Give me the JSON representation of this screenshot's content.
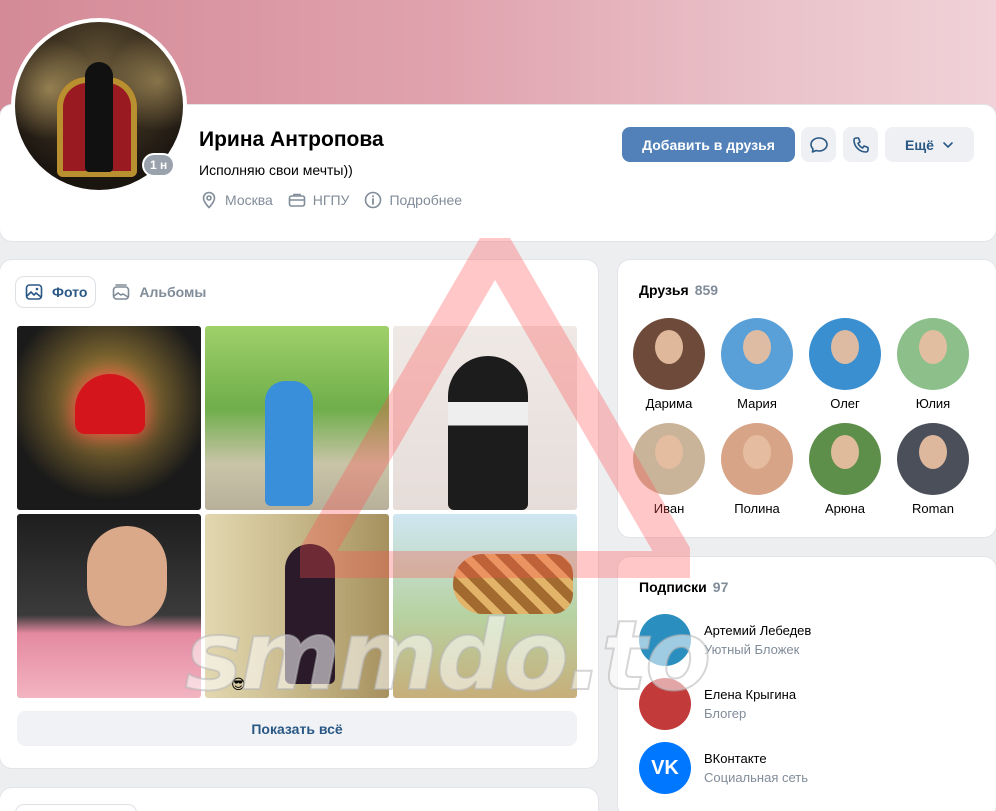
{
  "profile": {
    "name": "Ирина Антропова",
    "status": "Исполняю свои мечты))",
    "online": "1 н",
    "city": "Москва",
    "university": "НГПУ",
    "more_info": "Подробнее"
  },
  "actions": {
    "add_friend": "Добавить в друзья",
    "more": "Ещё",
    "message_icon": "message-icon",
    "call_icon": "phone-icon"
  },
  "photos": {
    "tabs": [
      {
        "label": "Фото",
        "active": true
      },
      {
        "label": "Альбомы",
        "active": false
      }
    ],
    "emoji": "😎",
    "show_all": "Показать всё"
  },
  "friends": {
    "title": "Друзья",
    "count": "859",
    "items": [
      {
        "name": "Дарима",
        "color": "#6d4a3a"
      },
      {
        "name": "Мария",
        "color": "#5aa0d8"
      },
      {
        "name": "Олег",
        "color": "#3a8fd0"
      },
      {
        "name": "Юлия",
        "color": "#8cbf8a"
      },
      {
        "name": "Иван",
        "color": "#c9b49a"
      },
      {
        "name": "Полина",
        "color": "#d8a488"
      },
      {
        "name": "Арюна",
        "color": "#5d8f4a"
      },
      {
        "name": "Roman",
        "color": "#4a4f5a"
      }
    ]
  },
  "subscriptions": {
    "title": "Подписки",
    "count": "97",
    "items": [
      {
        "name": "Артемий Лебедев",
        "desc": "Уютный Бложек",
        "color": "#2a8fbf"
      },
      {
        "name": "Елена Крыгина",
        "desc": "Блогер",
        "color": "#c23a3a"
      },
      {
        "name": "ВКонтакте",
        "desc": "Социальная сеть",
        "color": "#0077ff",
        "logo": "VK"
      }
    ]
  },
  "watermark": "smmdo.to",
  "colors": {
    "accent": "#5181b8",
    "link": "#2a5885",
    "secondary_text": "#818c99",
    "background": "#edeef0"
  }
}
